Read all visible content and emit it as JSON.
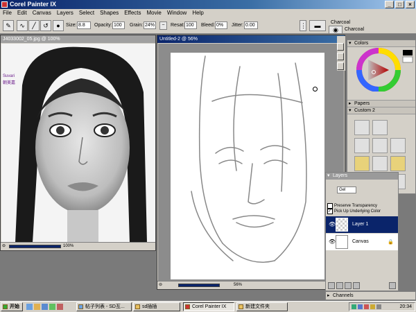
{
  "app": {
    "title": "Corel Painter IX"
  },
  "menu": [
    "File",
    "Edit",
    "Canvas",
    "Layers",
    "Select",
    "Shapes",
    "Effects",
    "Movie",
    "Window",
    "Help"
  ],
  "toolbar": {
    "size_label": "Size:",
    "size_value": "8.8",
    "opacity_label": "Opacity:",
    "opacity_value": "100",
    "grain_label": "Grain:",
    "grain_value": "24%",
    "resat_label": "Resat:",
    "resat_value": "100",
    "bleed_label": "Bleed:",
    "bleed_value": "0%",
    "jitter_label": "Jitter:",
    "jitter_value": "0.00",
    "brush_category": "Charcoal",
    "brush_variant": "Charcoal"
  },
  "photo_window": {
    "title": "J4033002_05.jpg @ 100%",
    "zoom": "100%",
    "watermark1": "Suvari",
    "watermark2": "朝美嘉"
  },
  "canvas_window": {
    "title": "Untitled-2 @ 56%",
    "zoom": "56%"
  },
  "colors_panel": {
    "title": "Colors"
  },
  "papers_panel": {
    "title": "Papers"
  },
  "custom_panel": {
    "title": "Custom 2"
  },
  "layers_panel": {
    "title": "Layers",
    "composite": "Gel",
    "preserve_transparency": "Preserve Transparency",
    "pick_up_color": "Pick Up Underlying Color",
    "layers": [
      "Layer 1",
      "Canvas"
    ]
  },
  "channels_panel": {
    "title": "Channels"
  },
  "taskbar": {
    "start": "开始",
    "items": [
      "帖子列表 - SD互...",
      "sd插插",
      "Corel Painter IX",
      "新建文件夹"
    ],
    "clock": "20:34"
  },
  "colors": {
    "title_start": "#0a246a",
    "title_end": "#a6caf0",
    "chrome": "#d4d0c8",
    "workspace": "#7a7a7a"
  }
}
